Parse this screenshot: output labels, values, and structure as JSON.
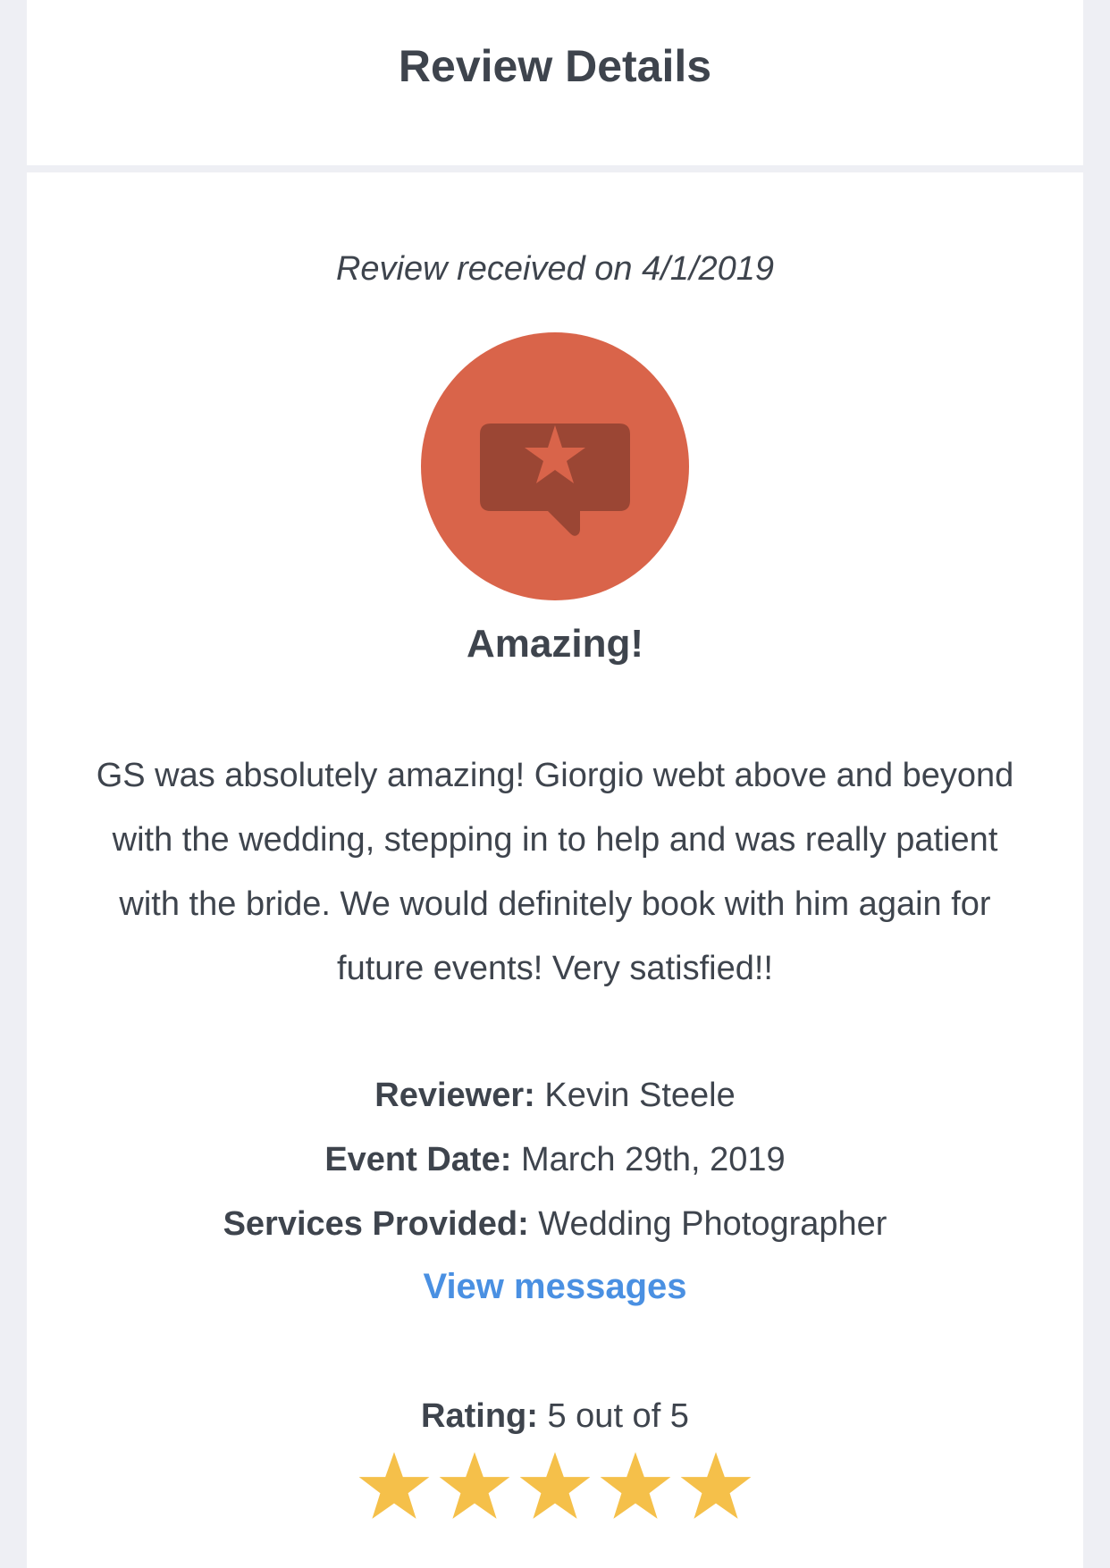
{
  "header": {
    "title": "Review Details"
  },
  "review": {
    "received": "Review received on 4/1/2019",
    "headline": "Amazing!",
    "text": "GS was absolutely amazing! Giorgio webt above and beyond with the wedding, stepping in to help and was really patient with the bride. We would definitely book with him again for future events! Very satisfied!!",
    "badge_icon": "review-star-bubble-icon"
  },
  "details": {
    "reviewer_label": "Reviewer:",
    "reviewer_value": "Kevin Steele",
    "event_date_label": "Event Date:",
    "event_date_value": "March 29th, 2019",
    "services_label": "Services Provided:",
    "services_value": "Wedding Photographer",
    "view_messages": "View messages"
  },
  "rating": {
    "label": "Rating:",
    "value_text": "5 out of 5",
    "score": 5,
    "max": 5
  },
  "colors": {
    "badge": "#d9644a",
    "badge_icon_dark": "#9b4634",
    "link": "#4a90e2",
    "star": "#f5c04a",
    "background": "#eeeff4",
    "text": "#3e444d"
  }
}
